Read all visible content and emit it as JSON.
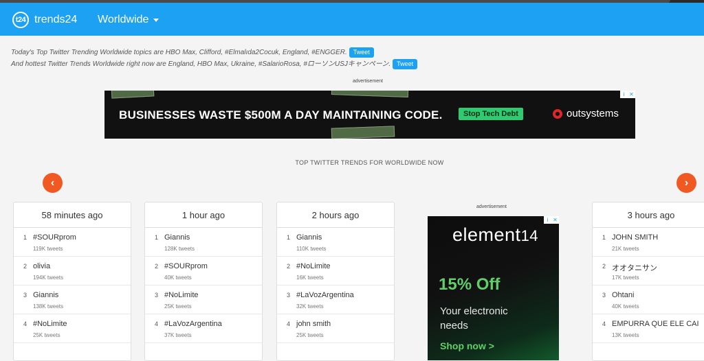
{
  "brand": {
    "logo": "t24",
    "name": "trends24"
  },
  "nav": {
    "region": "Worldwide"
  },
  "intro": {
    "line1": "Today's Top Twitter Trending Worldwide topics are HBO Max, Clifford, #Elmalıda2Cocuk, England, #ENGGER.",
    "line2": "And hottest Twitter Trends Worldwide right now are England, HBO Max, Ukraine, #SalarioRosa, #ローソンUSJキャンペーン.",
    "tweet": "Tweet"
  },
  "ads": {
    "label": "advertisement",
    "banner": {
      "headline": "BUSINESSES WASTE $500M A DAY MAINTAINING CODE.",
      "cta": "Stop Tech Debt",
      "brand": "outsystems"
    },
    "side": {
      "brand_main": "element",
      "brand_num": "14",
      "offer": "15% Off",
      "text": "Your electronic needs",
      "cta": "Shop now >"
    }
  },
  "section_title": "TOP TWITTER TRENDS FOR WORLDWIDE NOW",
  "arrows": {
    "prev": "‹",
    "next": "›"
  },
  "cards": [
    {
      "time": "58 minutes ago",
      "trends": [
        {
          "rank": "1",
          "name": "#SOURprom",
          "count": "119K tweets"
        },
        {
          "rank": "2",
          "name": "olivia",
          "count": "194K tweets"
        },
        {
          "rank": "3",
          "name": "Giannis",
          "count": "138K tweets"
        },
        {
          "rank": "4",
          "name": "#NoLimite",
          "count": "25K tweets"
        }
      ]
    },
    {
      "time": "1 hour ago",
      "trends": [
        {
          "rank": "1",
          "name": "Giannis",
          "count": "128K tweets"
        },
        {
          "rank": "2",
          "name": "#SOURprom",
          "count": "40K tweets"
        },
        {
          "rank": "3",
          "name": "#NoLimite",
          "count": "25K tweets"
        },
        {
          "rank": "4",
          "name": "#LaVozArgentina",
          "count": "37K tweets"
        }
      ]
    },
    {
      "time": "2 hours ago",
      "trends": [
        {
          "rank": "1",
          "name": "Giannis",
          "count": "110K tweets"
        },
        {
          "rank": "2",
          "name": "#NoLimite",
          "count": "16K tweets"
        },
        {
          "rank": "3",
          "name": "#LaVozArgentina",
          "count": "32K tweets"
        },
        {
          "rank": "4",
          "name": "john smith",
          "count": "25K tweets"
        }
      ]
    },
    {
      "time": "3 hours ago",
      "trends": [
        {
          "rank": "1",
          "name": "JOHN SMITH",
          "count": "21K tweets"
        },
        {
          "rank": "2",
          "name": "オオタニサン",
          "count": "17K tweets"
        },
        {
          "rank": "3",
          "name": "Ohtani",
          "count": "40K tweets"
        },
        {
          "rank": "4",
          "name": "EMPURRA QUE ELE CAI",
          "count": "13K tweets"
        }
      ]
    }
  ]
}
